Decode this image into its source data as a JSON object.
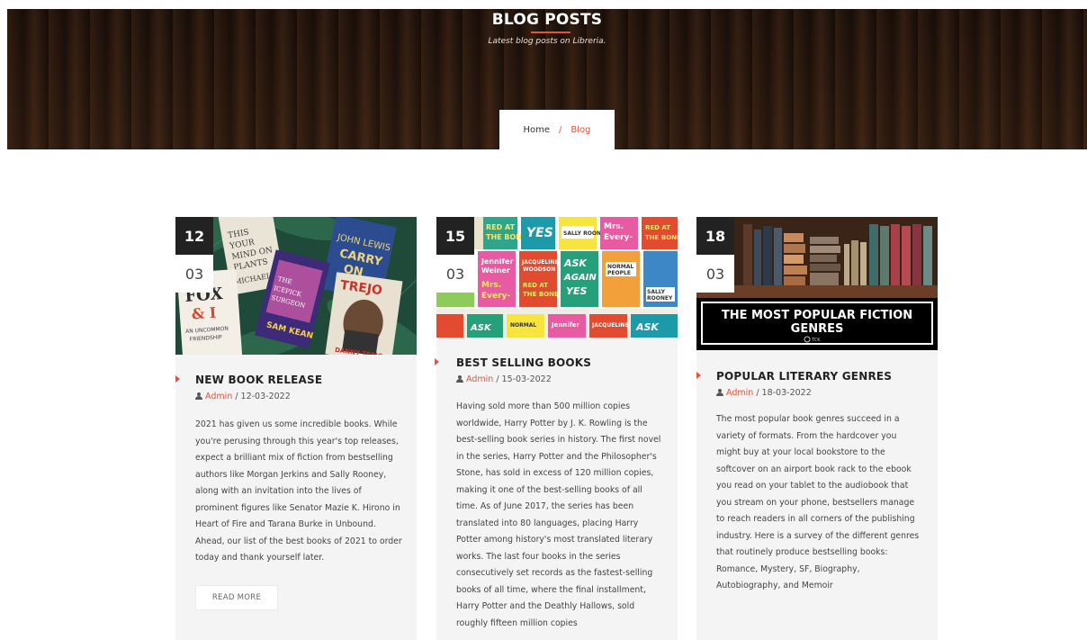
{
  "hero": {
    "title": "BLOG POSTS",
    "subtitle": "Latest blog posts on Libreria."
  },
  "breadcrumb": {
    "home": "Home",
    "separator": "/",
    "current": "Blog"
  },
  "accent_color": "#e0533e",
  "posts": [
    {
      "day": "12",
      "month": "03",
      "title": "NEW BOOK RELEASE",
      "author": "Admin",
      "date": "/ 12-03-2022",
      "excerpt": "2021 has given us some incredible books. While you're perusing through this year's top releases, expect a brilliant mix of fiction from bestselling authors like Morgan Jerkins and Sally Rooney, along with an invitation into the lives of prominent figures like Senator Mazie K. Hirono in Heart of Fire and Tarana Burke in Unbound. Ahead, our list of the best books of 2021 to order today and thank yourself later.",
      "read_more": "READ MORE",
      "image_books": [
        {
          "text": "THIS IS YOUR MIND ON PLANTS",
          "sub": "MICHAEL POLLAN"
        },
        {
          "text": "JOHN LEWIS CARRY ON",
          "sub": ""
        },
        {
          "text": "FOX & I",
          "sub": "AN UNCOMMON FRIENDSHIP"
        },
        {
          "text": "THE ICEPICK SURGEON",
          "sub": "SAM KEAN"
        },
        {
          "text": "TREJO",
          "sub": "DANNY TREJO"
        }
      ]
    },
    {
      "day": "15",
      "month": "03",
      "title": "BEST SELLING BOOKS",
      "author": "Admin",
      "date": "/ 15-03-2022",
      "excerpt": "Having sold more than 500 million copies worldwide, Harry Potter by J. K. Rowling is the best-selling book series in history. The first novel in the series, Harry Potter and the Philosopher's Stone, has sold in excess of 120 million copies, making it one of the best-selling books of all time. As of June 2017, the series has been translated into 80 languages, placing Harry Potter among history's most translated literary works. The last four books in the series consecutively set records as the fastest-selling books of all time, where the final installment, Harry Potter and the Deathly Hallows, sold roughly fifteen million copies",
      "image_tiles": [
        "RED AT THE BONE",
        "YES",
        "SALLY ROONEY",
        "Mrs. Every-thing",
        "RED AT THE BONE",
        "Jennifer Weiner",
        "JACQUELINE WOODSON",
        "ASK AGAIN YES",
        "NORMAL PEOPLE",
        "Mrs. Every-thing",
        "RED AT THE BONE",
        "SALLY ROONEY",
        "ASK",
        "NORMAL PEOPLE",
        "Jennifer Weiner",
        "JACQUELINE WOODSON",
        "ASK"
      ]
    },
    {
      "day": "18",
      "month": "03",
      "title": "POPULAR LITERARY GENRES",
      "author": "Admin",
      "date": "/ 18-03-2022",
      "excerpt": "The most popular book genres succeed in a variety of formats. From the hardcover you might buy at your local bookstore to the softcover on an airport book rack to the ebook you read on your tablet to the audiobook that you stream on your phone, bestsellers manage to reach readers in all corners of the publishing industry. Here is a survey of the different genres that routinely produce bestselling books: Romance, Mystery, SF, Biography, Autobiography, and Memoir",
      "image_caption": "THE MOST POPULAR FICTION GENRES",
      "image_brand": "TCK"
    }
  ]
}
